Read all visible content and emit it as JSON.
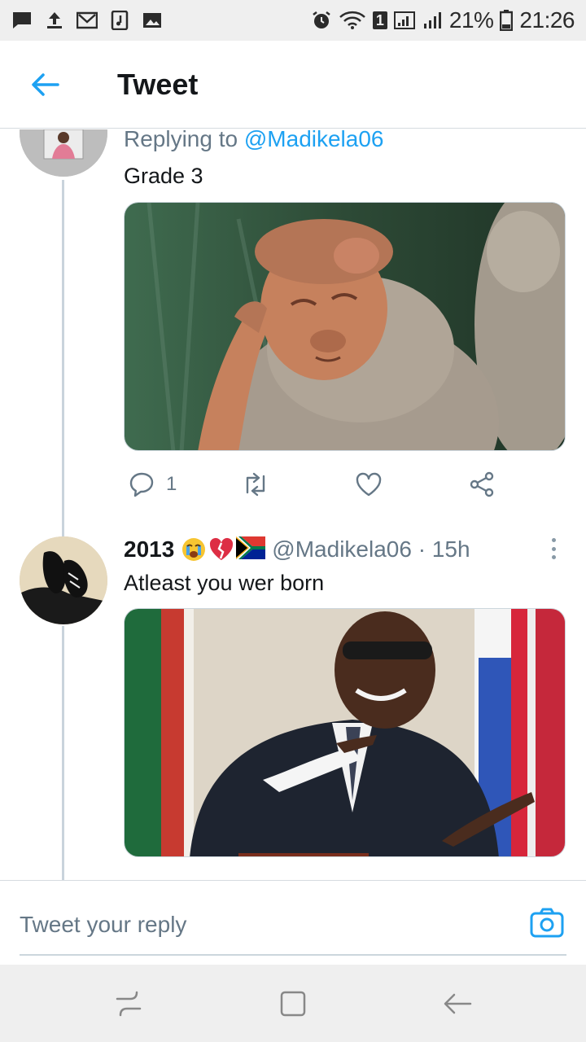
{
  "status_bar": {
    "battery": "21%",
    "time": "21:26",
    "sim": "1"
  },
  "header": {
    "title": "Tweet"
  },
  "first_tweet": {
    "replying_prefix": "Replying to ",
    "replying_handle": "@Madikela06",
    "text": "Grade 3",
    "media_alt": "monkey scratching head",
    "reply_count": "1"
  },
  "second_tweet": {
    "name": "2013",
    "emojis": [
      "crying-face",
      "broken-heart",
      "south-africa-flag"
    ],
    "meta": "@Madikela06 · 15h",
    "text": "Atleast you wer born",
    "media_alt": "man in suit laughing and pointing"
  },
  "composer": {
    "placeholder": "Tweet your reply"
  },
  "colors": {
    "accent": "#1da1f2",
    "muted": "#657786",
    "thread_line": "#c9d3dc"
  }
}
